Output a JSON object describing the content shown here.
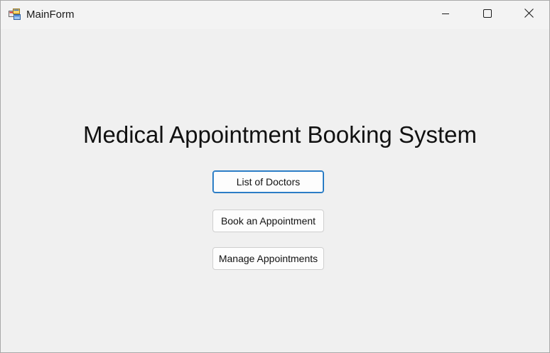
{
  "window": {
    "title": "MainForm",
    "app_icon": "winforms-app-icon",
    "controls": {
      "minimize_icon": "minimize-icon",
      "maximize_icon": "maximize-icon",
      "close_icon": "close-icon"
    }
  },
  "main": {
    "heading": "Medical Appointment Booking System",
    "buttons": {
      "list_doctors": "List of Doctors",
      "book_appointment": "Book an Appointment",
      "manage_appointments": "Manage Appointments"
    }
  },
  "colors": {
    "background": "#f0f0f0",
    "titlebar": "#f3f3f3",
    "focus_border": "#0f6cbd"
  }
}
